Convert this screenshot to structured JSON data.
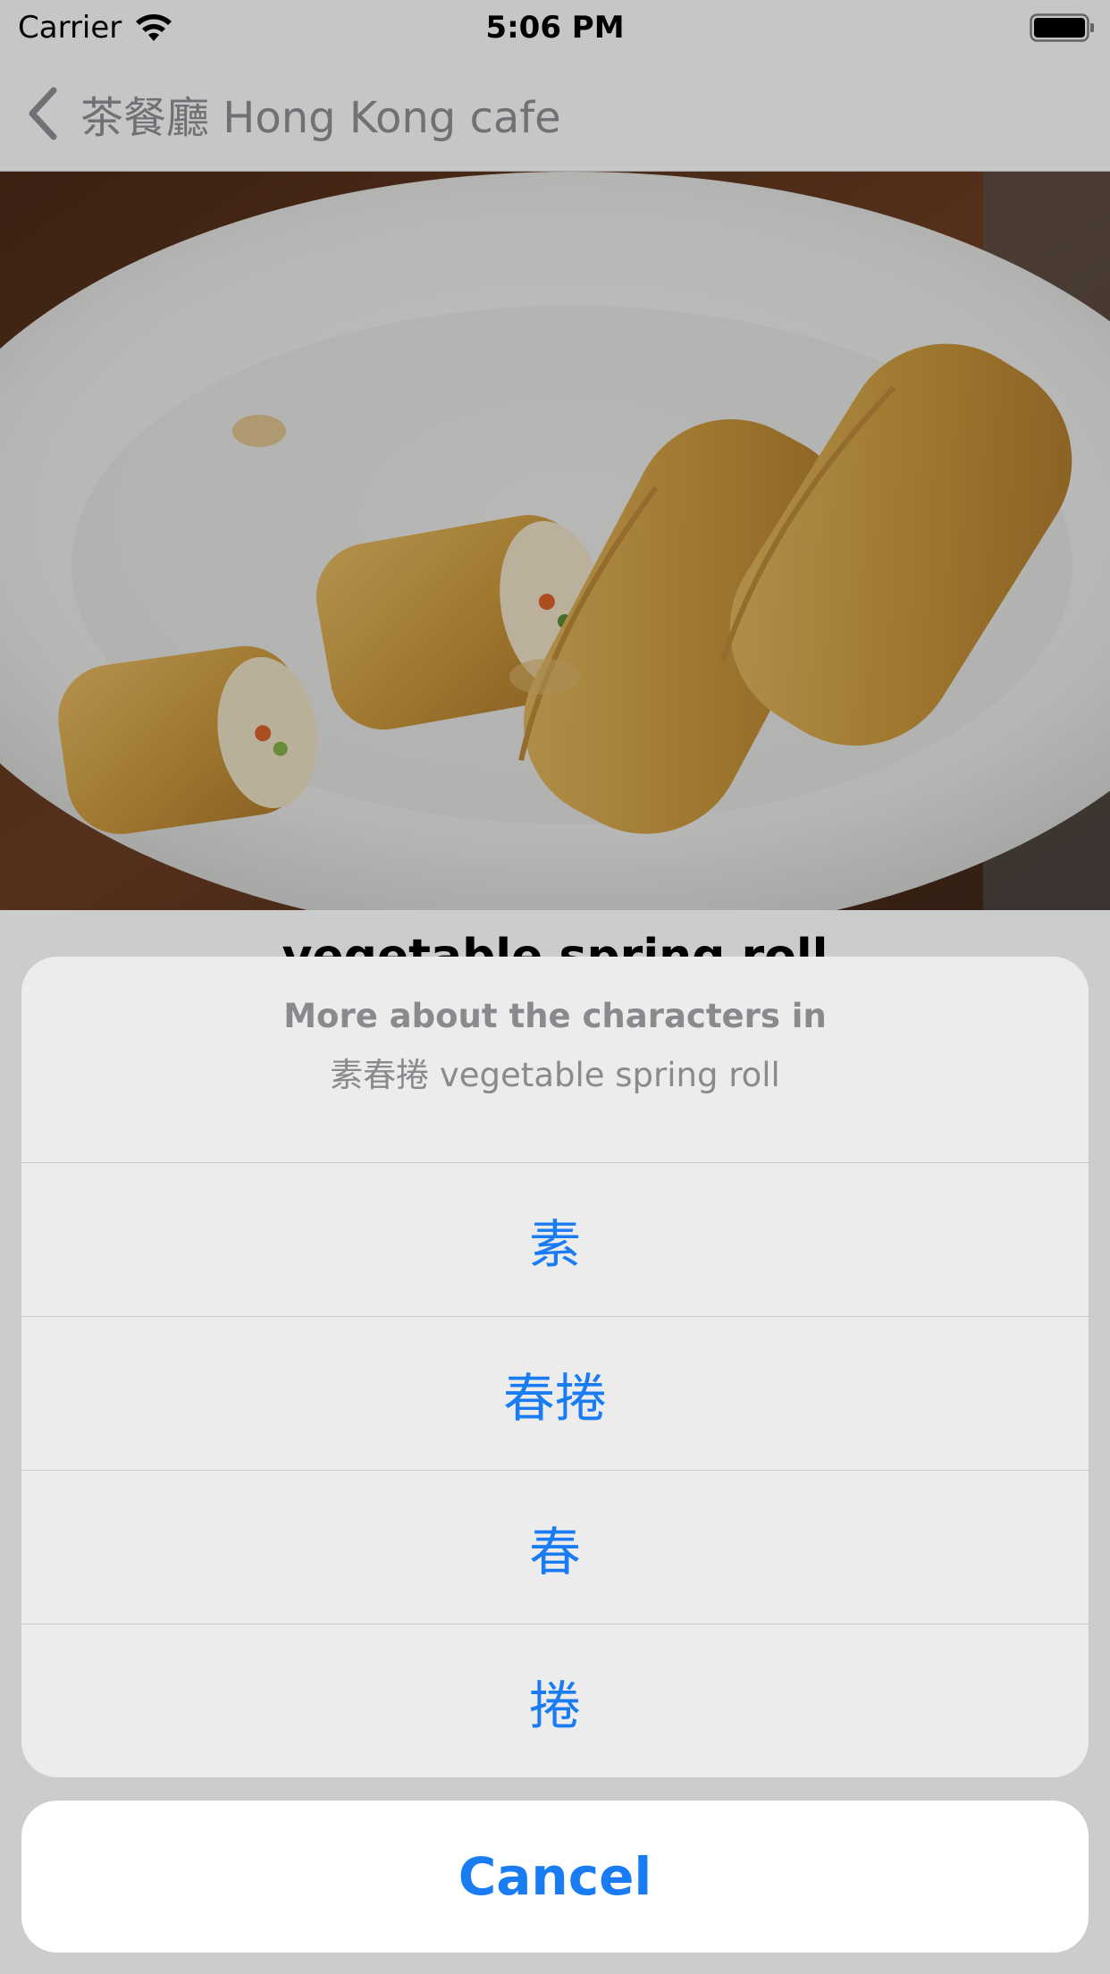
{
  "status_bar": {
    "carrier": "Carrier",
    "time": "5:06 PM",
    "icons": [
      "wifi-icon",
      "battery-icon"
    ]
  },
  "nav": {
    "back_label": "茶餐廳 Hong Kong cafe",
    "back_icon": "chevron-left-icon"
  },
  "photo": {
    "subject": "spring-rolls-photo"
  },
  "dish": {
    "title": "vegetable spring roll"
  },
  "action_sheet": {
    "title": "More about the characters in",
    "message": "素春捲 vegetable spring roll",
    "actions": [
      {
        "label": "素"
      },
      {
        "label": "春捲"
      },
      {
        "label": "春"
      },
      {
        "label": "捲"
      }
    ],
    "cancel_label": "Cancel"
  },
  "colors": {
    "tint": "#1a7cf2",
    "secondary_text": "#8a8a8e",
    "sheet_background": "#ececec"
  }
}
